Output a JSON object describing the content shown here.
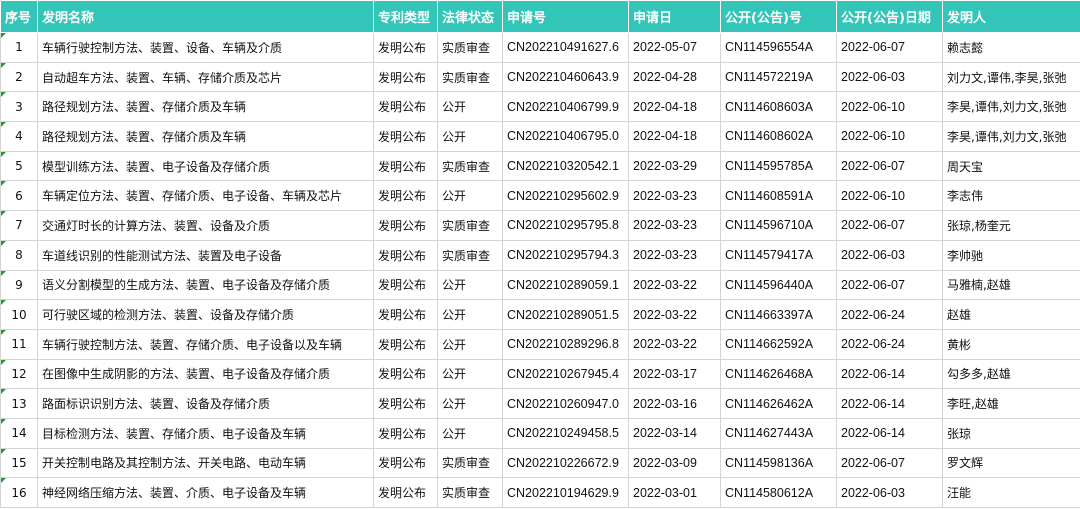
{
  "headers": [
    "序号",
    "发明名称",
    "专利类型",
    "法律状态",
    "申请号",
    "申请日",
    "公开(公告)号",
    "公开(公告)日期",
    "发明人"
  ],
  "rows": [
    [
      "1",
      "车辆行驶控制方法、装置、设备、车辆及介质",
      "发明公布",
      "实质审查",
      "CN202210491627.6",
      "2022-05-07",
      "CN114596554A",
      "2022-06-07",
      "赖志懿"
    ],
    [
      "2",
      "自动超车方法、装置、车辆、存储介质及芯片",
      "发明公布",
      "实质审查",
      "CN202210460643.9",
      "2022-04-28",
      "CN114572219A",
      "2022-06-03",
      "刘力文,谭伟,李昊,张弛"
    ],
    [
      "3",
      "路径规划方法、装置、存储介质及车辆",
      "发明公布",
      "公开",
      "CN202210406799.9",
      "2022-04-18",
      "CN114608603A",
      "2022-06-10",
      "李昊,谭伟,刘力文,张弛"
    ],
    [
      "4",
      "路径规划方法、装置、存储介质及车辆",
      "发明公布",
      "公开",
      "CN202210406795.0",
      "2022-04-18",
      "CN114608602A",
      "2022-06-10",
      "李昊,谭伟,刘力文,张弛"
    ],
    [
      "5",
      "模型训练方法、装置、电子设备及存储介质",
      "发明公布",
      "实质审查",
      "CN202210320542.1",
      "2022-03-29",
      "CN114595785A",
      "2022-06-07",
      "周天宝"
    ],
    [
      "6",
      "车辆定位方法、装置、存储介质、电子设备、车辆及芯片",
      "发明公布",
      "公开",
      "CN202210295602.9",
      "2022-03-23",
      "CN114608591A",
      "2022-06-10",
      "李志伟"
    ],
    [
      "7",
      "交通灯时长的计算方法、装置、设备及介质",
      "发明公布",
      "实质审查",
      "CN202210295795.8",
      "2022-03-23",
      "CN114596710A",
      "2022-06-07",
      "张琼,杨奎元"
    ],
    [
      "8",
      "车道线识别的性能测试方法、装置及电子设备",
      "发明公布",
      "实质审查",
      "CN202210295794.3",
      "2022-03-23",
      "CN114579417A",
      "2022-06-03",
      "李帅驰"
    ],
    [
      "9",
      "语义分割模型的生成方法、装置、电子设备及存储介质",
      "发明公布",
      "公开",
      "CN202210289059.1",
      "2022-03-22",
      "CN114596440A",
      "2022-06-07",
      "马雅楠,赵雄"
    ],
    [
      "10",
      "可行驶区域的检测方法、装置、设备及存储介质",
      "发明公布",
      "公开",
      "CN202210289051.5",
      "2022-03-22",
      "CN114663397A",
      "2022-06-24",
      "赵雄"
    ],
    [
      "11",
      "车辆行驶控制方法、装置、存储介质、电子设备以及车辆",
      "发明公布",
      "公开",
      "CN202210289296.8",
      "2022-03-22",
      "CN114662592A",
      "2022-06-24",
      "黄彬"
    ],
    [
      "12",
      "在图像中生成阴影的方法、装置、电子设备及存储介质",
      "发明公布",
      "公开",
      "CN202210267945.4",
      "2022-03-17",
      "CN114626468A",
      "2022-06-14",
      "勾多多,赵雄"
    ],
    [
      "13",
      "路面标识识别方法、装置、设备及存储介质",
      "发明公布",
      "公开",
      "CN202210260947.0",
      "2022-03-16",
      "CN114626462A",
      "2022-06-14",
      "李旺,赵雄"
    ],
    [
      "14",
      "目标检测方法、装置、存储介质、电子设备及车辆",
      "发明公布",
      "公开",
      "CN202210249458.5",
      "2022-03-14",
      "CN114627443A",
      "2022-06-14",
      "张琼"
    ],
    [
      "15",
      "开关控制电路及其控制方法、开关电路、电动车辆",
      "发明公布",
      "实质审查",
      "CN202210226672.9",
      "2022-03-09",
      "CN114598136A",
      "2022-06-07",
      "罗文辉"
    ],
    [
      "16",
      "神经网络压缩方法、装置、介质、电子设备及车辆",
      "发明公布",
      "实质审查",
      "CN202210194629.9",
      "2022-03-01",
      "CN114580612A",
      "2022-06-03",
      "汪能"
    ]
  ]
}
